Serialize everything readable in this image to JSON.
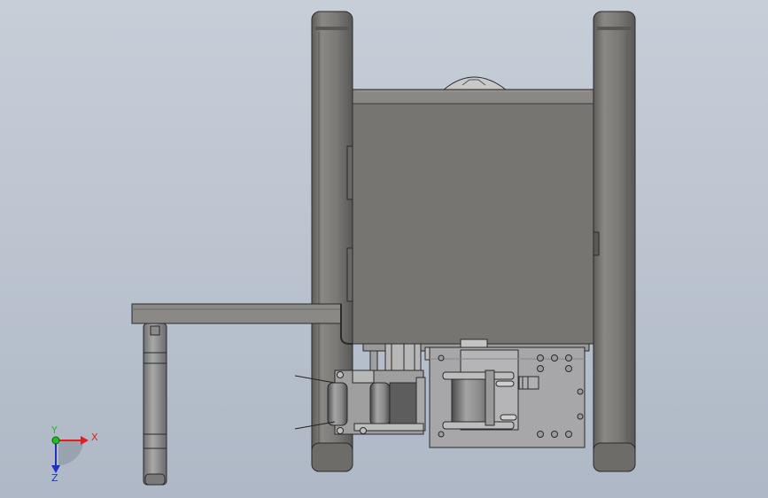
{
  "viewport": {
    "background_top": "#c6ced8",
    "background_bottom": "#aeb8c6"
  },
  "model": {
    "body_color": "#7a7875",
    "edge_color": "#2a2a2a",
    "metal_light": "#b8b8b8",
    "metal_mid": "#8e8e8e",
    "plate_color": "#a9a9ab"
  },
  "triad": {
    "x_label": "X",
    "y_label": "Y",
    "z_label": "Z",
    "x_color": "#e02020",
    "y_color": "#20c020",
    "z_color": "#2030d0"
  }
}
